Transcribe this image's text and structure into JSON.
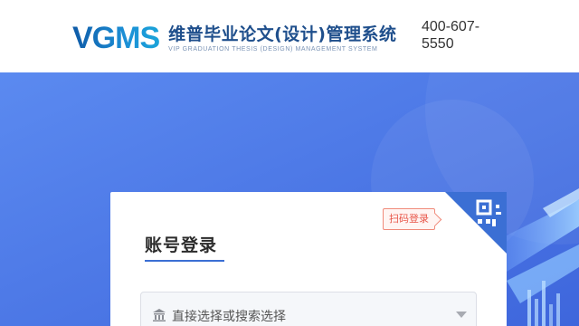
{
  "header": {
    "logo_mark": "VGMS",
    "system_name_cn": "维普毕业论文(设计)管理系统",
    "system_name_en": "VIP GRADUATION THESIS (DESIGN) MANAGEMENT SYSTEM",
    "phone": "400-607-5550"
  },
  "login": {
    "qr_login_label": "扫码登录",
    "title": "账号登录",
    "school_select": {
      "placeholder": "直接选择或搜索选择",
      "icon": "bank-icon"
    }
  },
  "colors": {
    "background": "#4b75e6",
    "brand_text": "#1f4f8c",
    "accent": "#3b6fd4",
    "qr_tag": "#e8574a"
  }
}
